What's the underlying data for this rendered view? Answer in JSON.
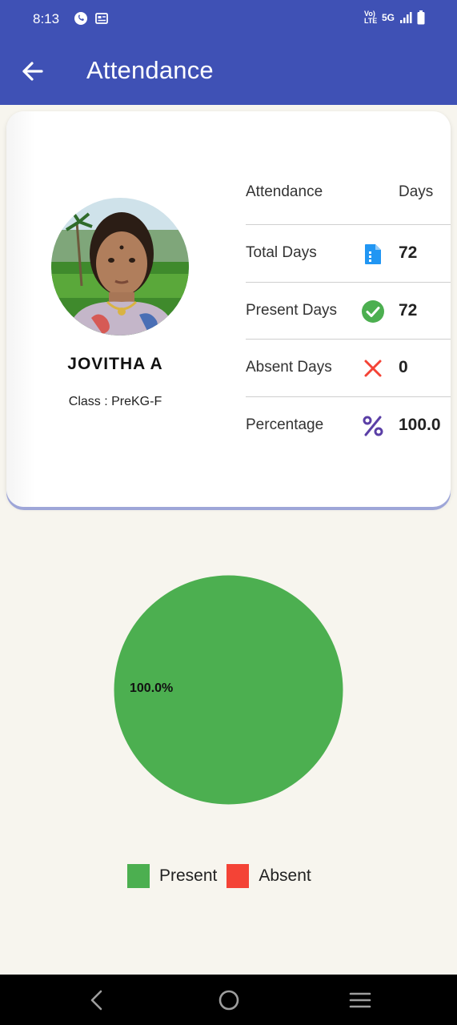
{
  "status": {
    "time": "8:13",
    "network": "5G",
    "volte": "Vo) LTE"
  },
  "appbar": {
    "title": "Attendance"
  },
  "student": {
    "name": "JOVITHA  A",
    "class": "Class : PreKG-F"
  },
  "stats": {
    "header_label": "Attendance",
    "header_days": "Days",
    "rows": [
      {
        "label": "Total Days",
        "icon": "document-icon",
        "icon_color": "#2196f3",
        "value": "72"
      },
      {
        "label": "Present Days",
        "icon": "check-circle-icon",
        "icon_color": "#4caf50",
        "value": "72"
      },
      {
        "label": "Absent Days",
        "icon": "close-icon",
        "icon_color": "#f44336",
        "value": "0"
      },
      {
        "label": "Percentage",
        "icon": "percent-icon",
        "icon_color": "#5b3fa6",
        "value": "100.0"
      }
    ]
  },
  "chart_data": {
    "type": "pie",
    "slices": [
      {
        "name": "Present",
        "value": 100.0,
        "color": "#4caf50"
      },
      {
        "name": "Absent",
        "value": 0.0,
        "color": "#f44336"
      }
    ],
    "data_label": "100.0%",
    "legend": [
      "Present",
      "Absent"
    ]
  },
  "colors": {
    "primary": "#3f51b5",
    "background": "#f7f5ee"
  }
}
